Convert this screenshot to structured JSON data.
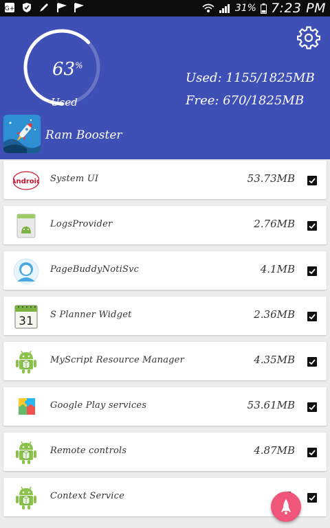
{
  "status_bar": {
    "left_icons": [
      "google-plus-icon",
      "shield-icon",
      "pen-icon",
      "flag-icon",
      "flag-icon"
    ],
    "battery": "31%",
    "time": "7:23 PM"
  },
  "header": {
    "gauge_percent": "63",
    "gauge_percent_unit": "%",
    "gauge_label": "Used",
    "gauge_fraction": 0.63,
    "used_text": "Used: 1155/1825MB",
    "free_text": "Free: 670/1825MB",
    "app_name": "Ram Booster",
    "background_color": "#3e4fb6"
  },
  "processes": [
    {
      "name": "System UI",
      "size": "53.73MB",
      "icon": "android-kitkat-icon",
      "checked": true
    },
    {
      "name": "LogsProvider",
      "size": "2.76MB",
      "icon": "logs-provider-icon",
      "checked": true
    },
    {
      "name": "PageBuddyNotiSvc",
      "size": "4.1MB",
      "icon": "person-avatar-icon",
      "checked": true
    },
    {
      "name": "S Planner Widget",
      "size": "2.36MB",
      "icon": "calendar-icon",
      "checked": true
    },
    {
      "name": "MyScript Resource Manager",
      "size": "4.35MB",
      "icon": "android-robot-icon",
      "checked": true
    },
    {
      "name": "Google Play services",
      "size": "53.61MB",
      "icon": "puzzle-piece-icon",
      "checked": true
    },
    {
      "name": "Remote controls",
      "size": "4.87MB",
      "icon": "android-robot-icon",
      "checked": true
    },
    {
      "name": "Context Service",
      "size": "5.",
      "icon": "android-robot-icon",
      "checked": true
    }
  ],
  "calendar_day": "31",
  "kitkat_text": "Android",
  "fab_color": "#f0567a"
}
